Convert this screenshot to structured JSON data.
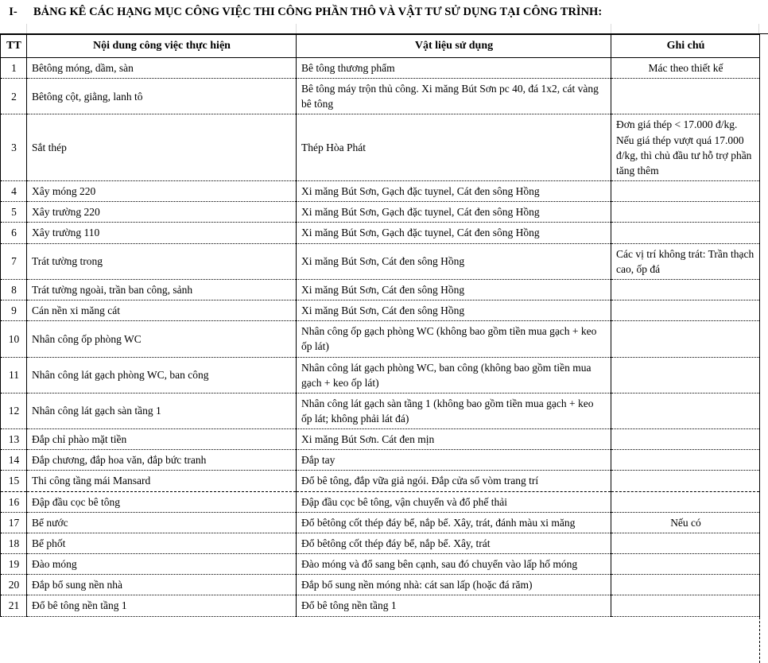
{
  "document": {
    "section_number": "I-",
    "title": "BẢNG KÊ CÁC HẠNG MỤC CÔNG VIỆC THI CÔNG PHẦN THÔ VÀ VẬT TƯ SỬ DỤNG TẠI CÔNG TRÌNH:"
  },
  "table": {
    "headers": {
      "tt": "TT",
      "noi_dung": "Nội dung công việc thực hiện",
      "vat_lieu": "Vật liệu sử dụng",
      "ghi_chu": "Ghi chú"
    },
    "rows": [
      {
        "tt": "1",
        "noi_dung": "Bêtông móng, dầm, sàn",
        "vat_lieu": "Bê tông thương phẩm",
        "ghi_chu": "Mác theo thiết kế"
      },
      {
        "tt": "2",
        "noi_dung": "Bêtông cột, giằng, lanh tô",
        "vat_lieu": "Bê tông máy trộn thủ công. Xi măng Bút Sơn pc 40, đá 1x2, cát vàng bê tông",
        "ghi_chu": ""
      },
      {
        "tt": "3",
        "noi_dung": "Sắt thép",
        "vat_lieu": "Thép Hòa Phát",
        "ghi_chu": "Đơn giá thép < 17.000 đ/kg. Nếu giá thép vượt quá 17.000 đ/kg, thì chủ đầu tư hỗ trợ phần tăng thêm"
      },
      {
        "tt": "4",
        "noi_dung": "Xây móng 220",
        "vat_lieu": "Xi măng Bút Sơn, Gạch đặc tuynel, Cát đen sông Hồng",
        "ghi_chu": ""
      },
      {
        "tt": "5",
        "noi_dung": "Xây trường 220",
        "vat_lieu": "Xi măng Bút Sơn, Gạch đặc tuynel, Cát đen sông Hồng",
        "ghi_chu": ""
      },
      {
        "tt": "6",
        "noi_dung": "Xây trường 110",
        "vat_lieu": "Xi măng Bút Sơn, Gạch đặc tuynel, Cát đen sông Hồng",
        "ghi_chu": ""
      },
      {
        "tt": "7",
        "noi_dung": "Trát tường trong",
        "vat_lieu": "Xi măng Bút Sơn, Cát đen sông Hồng",
        "ghi_chu": "Các vị trí không trát: Trần thạch cao, ốp đá"
      },
      {
        "tt": "8",
        "noi_dung": "Trát tường ngoài, trần ban công, sảnh",
        "vat_lieu": "Xi măng Bút Sơn, Cát đen sông Hồng",
        "ghi_chu": ""
      },
      {
        "tt": "9",
        "noi_dung": "Cán nền xi măng cát",
        "vat_lieu": "Xi măng Bút Sơn, Cát đen sông Hồng",
        "ghi_chu": ""
      },
      {
        "tt": "10",
        "noi_dung": "Nhân công ốp phòng WC",
        "vat_lieu": "Nhân công ốp gạch phòng WC (không bao gồm tiền mua gạch + keo ốp lát)",
        "ghi_chu": ""
      },
      {
        "tt": "11",
        "noi_dung": "Nhân công lát gạch phòng WC, ban công",
        "vat_lieu": "Nhân công lát gạch phòng WC, ban công (không bao gồm tiền mua gạch + keo ốp lát)",
        "ghi_chu": ""
      },
      {
        "tt": "12",
        "noi_dung": "Nhân công lát gạch sàn tầng 1",
        "vat_lieu": "Nhân công lát gạch sàn tầng 1 (không bao gồm tiền mua gạch + keo ốp lát; không phải lát đá)",
        "ghi_chu": ""
      },
      {
        "tt": "13",
        "noi_dung": "Đắp chỉ phào mặt tiền",
        "vat_lieu": "Xi măng Bút Sơn. Cát đen mịn",
        "ghi_chu": ""
      },
      {
        "tt": "14",
        "noi_dung": "Đắp chương, đắp hoa văn, đắp bức tranh",
        "vat_lieu": "Đắp tay",
        "ghi_chu": ""
      },
      {
        "tt": "15",
        "noi_dung": "Thi công tầng mái Mansard",
        "vat_lieu": "Đổ bê tông, đắp vữa giả ngói. Đắp cửa sổ vòm trang trí",
        "ghi_chu": ""
      },
      {
        "tt": "16",
        "noi_dung": "Đập đầu cọc bê tông",
        "vat_lieu": "Đập đầu cọc bê tông, vận chuyển và đổ phế thải",
        "ghi_chu": ""
      },
      {
        "tt": "17",
        "noi_dung": "Bể nước",
        "vat_lieu": "Đổ bêtông cốt thép đáy bể, nắp bể. Xây, trát, đánh màu xi măng",
        "ghi_chu": "Nếu có"
      },
      {
        "tt": "18",
        "noi_dung": "Bể phốt",
        "vat_lieu": "Đổ bêtông cốt thép đáy bể, nắp bể. Xây, trát",
        "ghi_chu": ""
      },
      {
        "tt": "19",
        "noi_dung": "Đào móng",
        "vat_lieu": "Đào móng và đổ sang bên cạnh, sau đó chuyển vào lấp hố móng",
        "ghi_chu": ""
      },
      {
        "tt": "20",
        "noi_dung": "Đắp bổ sung nền nhà",
        "vat_lieu": "Đắp bổ sung nền móng nhà: cát san lấp (hoặc đá răm)",
        "ghi_chu": ""
      },
      {
        "tt": "21",
        "noi_dung": "Đổ bê tông nền tầng 1",
        "vat_lieu": "Đổ bê tông nền tầng 1",
        "ghi_chu": ""
      }
    ]
  }
}
